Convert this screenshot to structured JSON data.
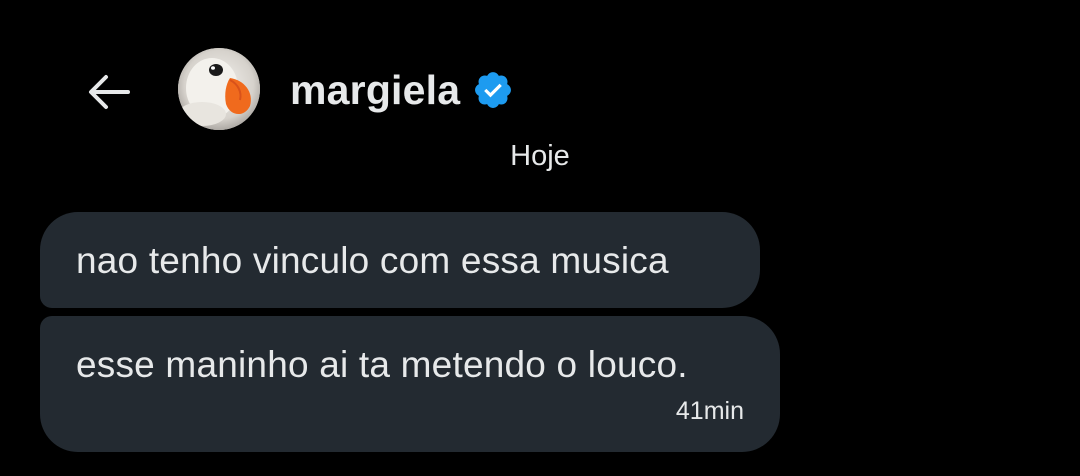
{
  "header": {
    "username": "margiela",
    "verified": true
  },
  "date_separator": "Hoje",
  "messages": [
    {
      "text": "nao tenho vinculo com essa musica",
      "time": ""
    },
    {
      "text": "esse maninho ai ta metendo o louco.",
      "time": "41min"
    }
  ],
  "colors": {
    "background": "#000000",
    "bubble": "#232a31",
    "text": "#e7e9ea",
    "verified": "#1d9bf0"
  },
  "icons": {
    "back": "back-arrow-icon",
    "verified": "verified-badge-icon"
  }
}
